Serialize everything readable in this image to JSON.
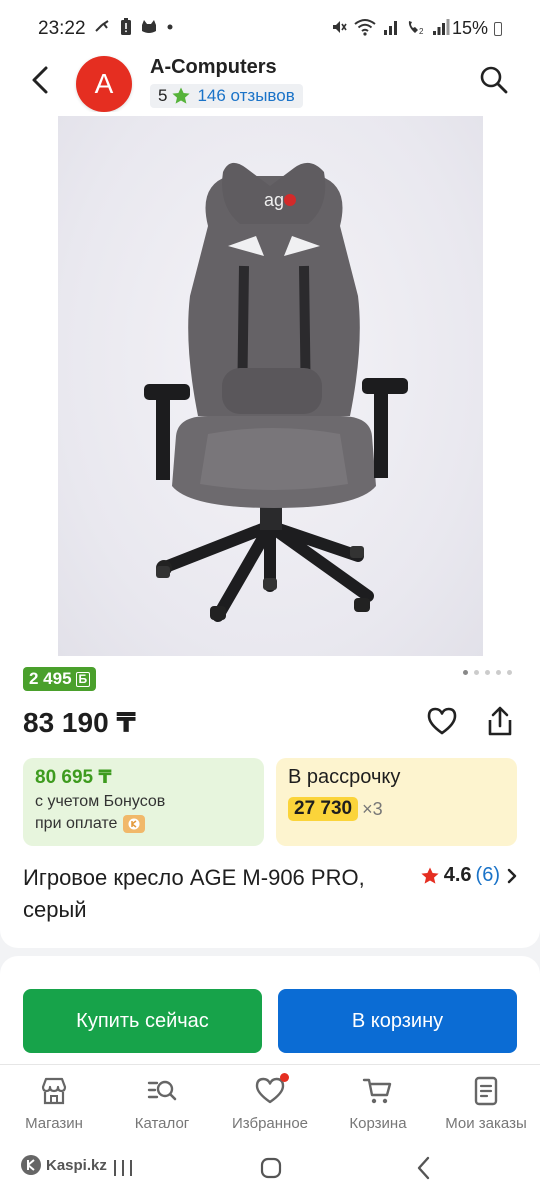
{
  "status_bar": {
    "time": "23:22",
    "battery": "15%",
    "left_icons": [
      "vpn-key-icon",
      "battery-alert-icon",
      "cat-icon",
      "dot-icon"
    ],
    "right_icons": [
      "mute-icon",
      "wifi-icon",
      "signal-r-icon",
      "call-volte-icon",
      "signal-icon"
    ]
  },
  "header": {
    "avatar_letter": "A",
    "shop_name": "A-Computers",
    "rating_score": "5",
    "reviews": "146 отзывов",
    "accent": "#e52e21"
  },
  "product": {
    "bonus_amount": "2 495",
    "bonus_symbol": "Б",
    "price": "83 190 ₸",
    "image_count": 5,
    "image_active_index": 0,
    "bonus_promo": {
      "amount": "80 695 ₸",
      "line1": "с учетом Бонусов",
      "line2": "при оплате"
    },
    "installment": {
      "title": "В рассрочку",
      "monthly": "27 730",
      "months": "×3"
    },
    "title": "Игровое кресло AGE M-906 PRO, серый",
    "rating": "4.6",
    "rating_count": "(6)"
  },
  "actions": {
    "buy_now": "Купить сейчас",
    "add_to_cart": "В корзину"
  },
  "tabs": [
    {
      "label": "Магазин",
      "icon": "shop-icon"
    },
    {
      "label": "Каталог",
      "icon": "catalog-search-icon"
    },
    {
      "label": "Избранное",
      "icon": "heart-icon",
      "has_notification": true
    },
    {
      "label": "Корзина",
      "icon": "cart-icon"
    },
    {
      "label": "Мои заказы",
      "icon": "orders-icon"
    }
  ],
  "nav_bar": {
    "brand": "Kaspi.kz"
  },
  "colors": {
    "green_button": "#17a34a",
    "blue_button": "#0b6cd4",
    "bonus_green": "#4aa02c",
    "installment_yellow": "#fbd43a",
    "link_blue": "#1a73c8"
  }
}
